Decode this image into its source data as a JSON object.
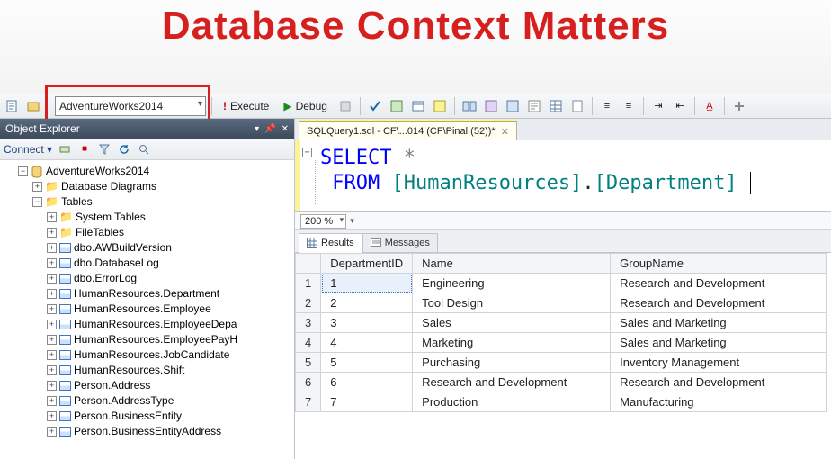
{
  "overlay_title": "Database Context Matters",
  "toolbar": {
    "database_selected": "AdventureWorks2014",
    "execute_label": "Execute",
    "debug_label": "Debug"
  },
  "object_explorer": {
    "title": "Object Explorer",
    "connect_label": "Connect",
    "root_db": "AdventureWorks2014",
    "folders": {
      "diagrams": "Database Diagrams",
      "tables": "Tables",
      "system_tables": "System Tables",
      "file_tables": "FileTables"
    },
    "tables": [
      "dbo.AWBuildVersion",
      "dbo.DatabaseLog",
      "dbo.ErrorLog",
      "HumanResources.Department",
      "HumanResources.Employee",
      "HumanResources.EmployeeDepa",
      "HumanResources.EmployeePayH",
      "HumanResources.JobCandidate",
      "HumanResources.Shift",
      "Person.Address",
      "Person.AddressType",
      "Person.BusinessEntity",
      "Person.BusinessEntityAddress"
    ]
  },
  "editor": {
    "tab_label": "SQLQuery1.sql - CF\\...014 (CF\\Pinal (52))*",
    "sql_select": "SELECT",
    "sql_from": "FROM",
    "sql_star": "*",
    "sql_schema": "[HumanResources]",
    "sql_table": "[Department]",
    "zoom": "200 %"
  },
  "results": {
    "tab_results": "Results",
    "tab_messages": "Messages",
    "columns": [
      "DepartmentID",
      "Name",
      "GroupName"
    ],
    "rows": [
      {
        "n": 1,
        "DepartmentID": "1",
        "Name": "Engineering",
        "GroupName": "Research and Development"
      },
      {
        "n": 2,
        "DepartmentID": "2",
        "Name": "Tool Design",
        "GroupName": "Research and Development"
      },
      {
        "n": 3,
        "DepartmentID": "3",
        "Name": "Sales",
        "GroupName": "Sales and Marketing"
      },
      {
        "n": 4,
        "DepartmentID": "4",
        "Name": "Marketing",
        "GroupName": "Sales and Marketing"
      },
      {
        "n": 5,
        "DepartmentID": "5",
        "Name": "Purchasing",
        "GroupName": "Inventory Management"
      },
      {
        "n": 6,
        "DepartmentID": "6",
        "Name": "Research and Development",
        "GroupName": "Research and Development"
      },
      {
        "n": 7,
        "DepartmentID": "7",
        "Name": "Production",
        "GroupName": "Manufacturing"
      }
    ]
  },
  "colors": {
    "highlight": "#d61f1f",
    "keyword": "#0000ff",
    "object": "#008080"
  }
}
